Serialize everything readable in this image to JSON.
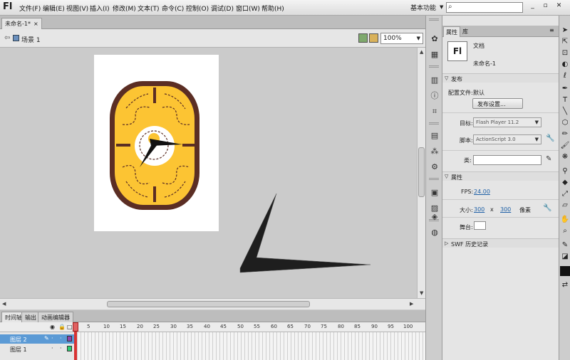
{
  "app": {
    "logo": "Fl",
    "menus": [
      "文件(F)",
      "编辑(E)",
      "视图(V)",
      "插入(I)",
      "修改(M)",
      "文本(T)",
      "命令(C)",
      "控制(O)",
      "调试(D)",
      "窗口(W)",
      "帮助(H)"
    ],
    "workspace": "基本功能",
    "search_placeholder": "",
    "window_buttons": [
      "_",
      "▫",
      "✕"
    ]
  },
  "document": {
    "tab_label": "未命名-1*",
    "tab_close": "×"
  },
  "scene": {
    "label": "场景 1",
    "zoom": "100%"
  },
  "timeline": {
    "tabs": [
      "时间轴",
      "输出",
      "动画编辑器"
    ],
    "frame_numbers": [
      "1",
      "5",
      "10",
      "15",
      "20",
      "25",
      "30",
      "35",
      "40",
      "45",
      "50",
      "55",
      "60",
      "65",
      "70",
      "75",
      "80",
      "85",
      "90",
      "95",
      "100"
    ],
    "layers": [
      {
        "name": "图层 2",
        "selected": true,
        "color": "#8e44ad"
      },
      {
        "name": "图层 1",
        "selected": false,
        "color": "#2ecc71"
      }
    ]
  },
  "properties": {
    "tabs": [
      "属性",
      "库"
    ],
    "doc_icon": "Fl",
    "doc_type": "文档",
    "doc_name": "未命名-1",
    "section_publish": "发布",
    "profile_label": "配置文件:",
    "profile_value": "默认",
    "publish_settings_button": "发布设置...",
    "target_label": "目标:",
    "target_value": "Flash Player 11.2",
    "script_label": "脚本:",
    "script_value": "ActionScript 3.0",
    "class_label": "类:",
    "section_properties": "属性",
    "fps_label": "FPS:",
    "fps_value": "24.00",
    "size_label": "大小:",
    "width_value": "300",
    "x_sep": "x",
    "height_value": "300",
    "unit": "像素",
    "stage_label": "舞台:",
    "swf_history": "SWF 历史记录"
  },
  "colors": {
    "clock_yellow": "#fcc433",
    "clock_brown": "#5b2e24",
    "stage": "#ffffff",
    "pasteboard": "#cbcbcb"
  }
}
